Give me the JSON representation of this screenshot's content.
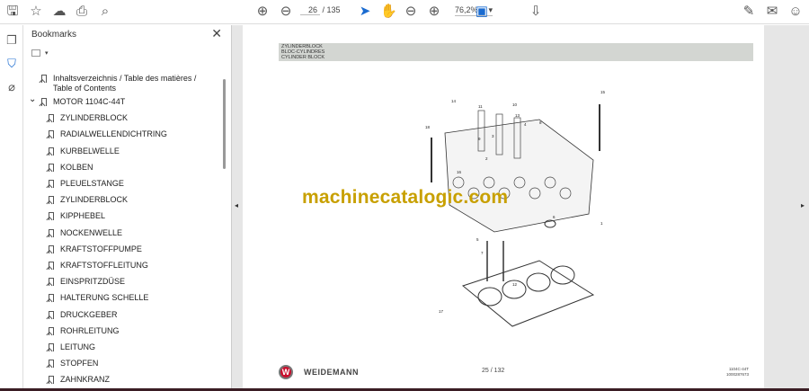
{
  "toolbar": {
    "page_current": "26",
    "page_total": "/ 135",
    "zoom": "76,2%",
    "icons": [
      "save-icon",
      "star-icon",
      "upload-icon",
      "print-icon",
      "search-icon",
      "page-up-icon",
      "page-down-icon",
      "select-cursor-icon",
      "hand-icon",
      "zoom-out-icon",
      "zoom-in-icon",
      "fit-page-icon",
      "scroll-mode-icon",
      "sign-icon",
      "email-icon",
      "account-icon"
    ]
  },
  "bookmarks": {
    "title": "Bookmarks",
    "items": [
      {
        "label": "Inhaltsverzeichnis / Table des matières / Table of Contents",
        "level": 0
      },
      {
        "label": "MOTOR 1104C-44T",
        "level": 0,
        "expanded": true
      },
      {
        "label": "ZYLINDERBLOCK",
        "level": 1
      },
      {
        "label": "RADIALWELLENDICHTRING",
        "level": 1
      },
      {
        "label": "KURBELWELLE",
        "level": 1
      },
      {
        "label": "KOLBEN",
        "level": 1
      },
      {
        "label": "PLEUELSTANGE",
        "level": 1
      },
      {
        "label": "ZYLINDERBLOCK",
        "level": 1
      },
      {
        "label": "KIPPHEBEL",
        "level": 1
      },
      {
        "label": "NOCKENWELLE",
        "level": 1
      },
      {
        "label": "KRAFTSTOFFPUMPE",
        "level": 1
      },
      {
        "label": "KRAFTSTOFFLEITUNG",
        "level": 1
      },
      {
        "label": "EINSPRITZDÜSE",
        "level": 1
      },
      {
        "label": "HALTERUNG SCHELLE",
        "level": 1
      },
      {
        "label": "DRUCKGEBER",
        "level": 1
      },
      {
        "label": "ROHRLEITUNG",
        "level": 1
      },
      {
        "label": "LEITUNG",
        "level": 1
      },
      {
        "label": "STOPFEN",
        "level": 1
      },
      {
        "label": "ZAHNKRANZ",
        "level": 1
      }
    ]
  },
  "document": {
    "header": [
      "ZYLINDERBLOCK",
      "BLOC-CYLINDRES",
      "CYLINDER BLOCK"
    ],
    "watermark": "machinecatalogic.com",
    "brand": "WEIDEMANN",
    "page_label": "25 / 132",
    "model": "1104C-44T",
    "part_code": "1000287673",
    "callouts": [
      "1",
      "2",
      "3",
      "4",
      "5",
      "6",
      "7",
      "8",
      "9",
      "10",
      "11",
      "12",
      "13",
      "14",
      "15",
      "16",
      "17",
      "18"
    ]
  }
}
